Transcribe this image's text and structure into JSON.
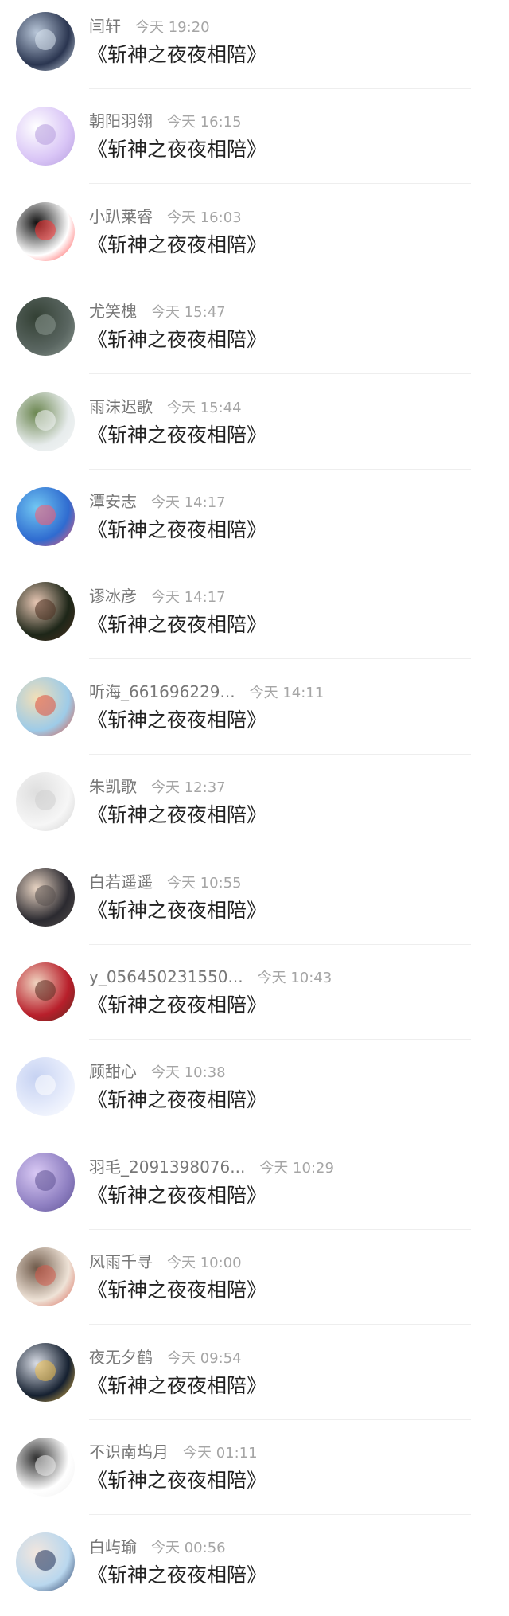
{
  "items": [
    {
      "name": "闫轩",
      "time": "今天 19:20",
      "title": "《斩神之夜夜相陪》",
      "avatar_icon": "anime-figure-dark-avatar",
      "colors": [
        "#2a3550",
        "#b8c6d8",
        "#d9e4ef"
      ]
    },
    {
      "name": "朝阳羽翎",
      "time": "今天 16:15",
      "title": "《斩神之夜夜相陪》",
      "avatar_icon": "chat-bubble-avatar",
      "colors": [
        "#d9c5f6",
        "#ffffff",
        "#b49bdd"
      ]
    },
    {
      "name": "小趴莱睿",
      "time": "今天 16:03",
      "title": "《斩神之夜夜相陪》",
      "avatar_icon": "penguin-avatar",
      "colors": [
        "#ffffff",
        "#111111",
        "#ff3333"
      ]
    },
    {
      "name": "尤笑槐",
      "time": "今天 15:47",
      "title": "《斩神之夜夜相陪》",
      "avatar_icon": "figure-in-fog-avatar",
      "colors": [
        "#5a6661",
        "#334034",
        "#8d9991"
      ]
    },
    {
      "name": "雨沫迟歌",
      "time": "今天 15:44",
      "title": "《斩神之夜夜相陪》",
      "avatar_icon": "white-cat-avatar",
      "colors": [
        "#e7ecec",
        "#6b8650",
        "#f4f6f7"
      ]
    },
    {
      "name": "潭安志",
      "time": "今天 14:17",
      "title": "《斩神之夜夜相陪》",
      "avatar_icon": "blue-cartoon-avatar",
      "colors": [
        "#2f6bd0",
        "#71c7f2",
        "#ff5a6e"
      ]
    },
    {
      "name": "谬冰彦",
      "time": "今天 14:17",
      "title": "《斩神之夜夜相陪》",
      "avatar_icon": "girl-portrait-avatar",
      "colors": [
        "#1d2618",
        "#e7c6b3",
        "#4c3020"
      ]
    },
    {
      "name": "听海_661696229...",
      "time": "今天 14:11",
      "title": "《斩神之夜夜相陪》",
      "avatar_icon": "beach-couple-avatar",
      "colors": [
        "#9dcbe8",
        "#f1dfb8",
        "#e04e3c"
      ]
    },
    {
      "name": "朱凯歌",
      "time": "今天 12:37",
      "title": "《斩神之夜夜相陪》",
      "avatar_icon": "faint-white-avatar",
      "colors": [
        "#f6f6f6",
        "#dedede",
        "#cfcfcf"
      ]
    },
    {
      "name": "白若遥遥",
      "time": "今天 10:55",
      "title": "《斩神之夜夜相陪》",
      "avatar_icon": "dark-hair-boy-avatar",
      "colors": [
        "#2b2a30",
        "#e8d4c3",
        "#57514e"
      ]
    },
    {
      "name": "y_056450231550...",
      "time": "今天 10:43",
      "title": "《斩神之夜夜相陪》",
      "avatar_icon": "red-hat-girl-avatar",
      "colors": [
        "#b81f2b",
        "#f0d4c0",
        "#5a2a1f"
      ]
    },
    {
      "name": "顾甜心",
      "time": "今天 10:38",
      "title": "《斩神之夜夜相陪》",
      "avatar_icon": "white-dress-girl-avatar",
      "colors": [
        "#e9eefc",
        "#c6d2f2",
        "#ffffff"
      ]
    },
    {
      "name": "羽毛_2091398076...",
      "time": "今天 10:29",
      "title": "《斩神之夜夜相陪》",
      "avatar_icon": "purple-tree-avatar",
      "colors": [
        "#8f80c2",
        "#d9c9f4",
        "#5e5294"
      ]
    },
    {
      "name": "风雨千寻",
      "time": "今天 10:00",
      "title": "《斩神之夜夜相陪》",
      "avatar_icon": "hooded-girl-avatar",
      "colors": [
        "#efe3d7",
        "#6f5a4a",
        "#d45a4a"
      ]
    },
    {
      "name": "夜无夕鹤",
      "time": "今天 09:54",
      "title": "《斩神之夜夜相陪》",
      "avatar_icon": "silver-hair-boy-avatar",
      "colors": [
        "#152030",
        "#d9dde6",
        "#f0c04a"
      ]
    },
    {
      "name": "不识南坞月",
      "time": "今天 01:11",
      "title": "《斩神之夜夜相陪》",
      "avatar_icon": "sketch-couple-avatar",
      "colors": [
        "#ffffff",
        "#2f2f2f",
        "#eeeeee"
      ]
    },
    {
      "name": "白屿瑜",
      "time": "今天 00:56",
      "title": "《斩神之夜夜相陪》",
      "avatar_icon": "anime-boys-avatar",
      "colors": [
        "#b9d7ee",
        "#f2e6de",
        "#1b2e57"
      ]
    }
  ]
}
